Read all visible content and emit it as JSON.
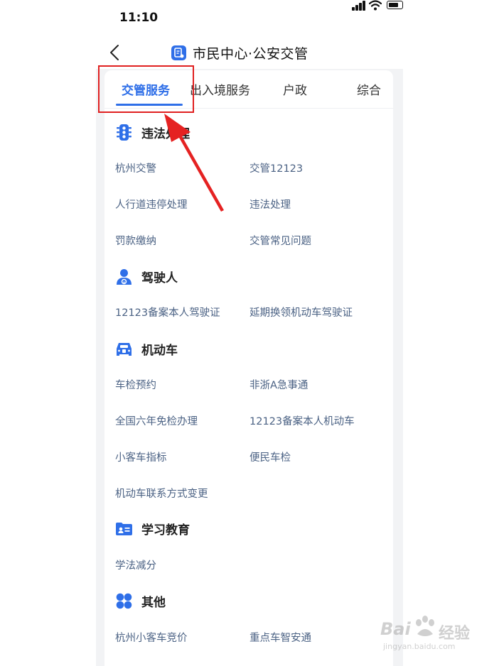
{
  "status_bar": {
    "time": "11:10"
  },
  "nav": {
    "title": "市民中心·公安交管"
  },
  "tabs": [
    {
      "label": "交管服务",
      "active": true
    },
    {
      "label": "出入境服务",
      "active": false
    },
    {
      "label": "户政",
      "active": false
    },
    {
      "label": "综合",
      "active": false
    }
  ],
  "sections": [
    {
      "title": "违法处理",
      "icon": "traffic-light-icon",
      "links": [
        "杭州交警",
        "交管12123",
        "人行道违停处理",
        "违法处理",
        "罚款缴纳",
        "交管常见问题"
      ]
    },
    {
      "title": "驾驶人",
      "icon": "driver-icon",
      "links": [
        "12123备案本人驾驶证",
        "延期换领机动车驾驶证"
      ]
    },
    {
      "title": "机动车",
      "icon": "car-icon",
      "links": [
        "车检预约",
        "非浙A急事通",
        "全国六年免检办理",
        "12123备案本人机动车",
        "小客车指标",
        "便民车检",
        "机动车联系方式变更"
      ]
    },
    {
      "title": "学习教育",
      "icon": "id-card-icon",
      "links": [
        "学法减分"
      ]
    },
    {
      "title": "其他",
      "icon": "grid-icon",
      "links": [
        "杭州小客车竞价",
        "重点车智安通"
      ]
    }
  ],
  "watermark": {
    "brand_a": "Bai",
    "brand_b": "经验",
    "domain": "jingyan.baidu.com"
  },
  "colors": {
    "accent": "#2f6fe8",
    "link": "#4b6284",
    "annotation": "#e02020"
  }
}
